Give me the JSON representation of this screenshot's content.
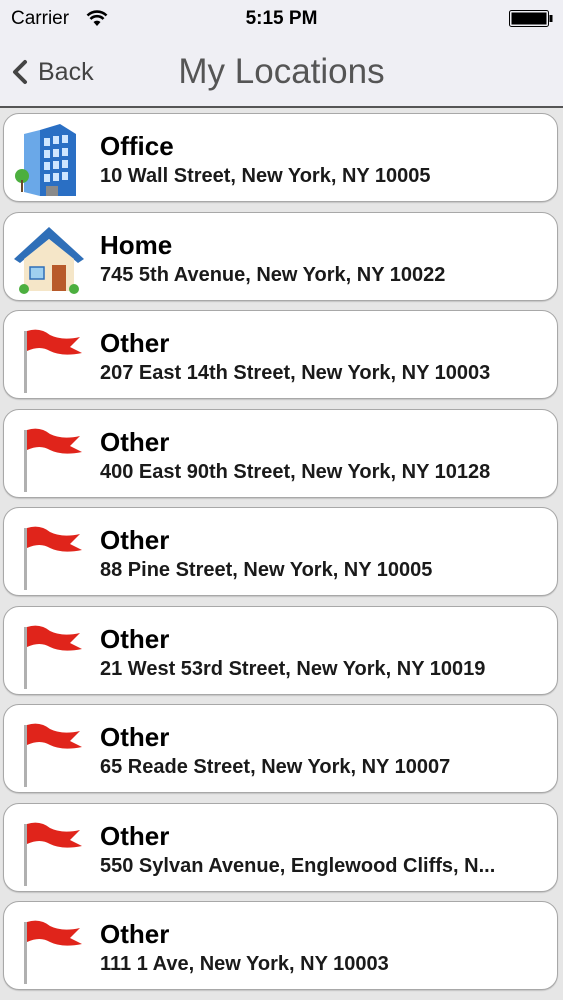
{
  "status_bar": {
    "carrier": "Carrier",
    "time": "5:15 PM"
  },
  "nav": {
    "back_label": "Back",
    "title": "My Locations"
  },
  "locations": [
    {
      "name": "Office",
      "address": "10 Wall Street, New York, NY 10005",
      "icon": "office-building-icon"
    },
    {
      "name": "Home",
      "address": "745 5th Avenue, New York, NY 10022",
      "icon": "house-icon"
    },
    {
      "name": "Other",
      "address": "207 East 14th Street, New York, NY 10003",
      "icon": "red-flag-icon"
    },
    {
      "name": "Other",
      "address": "400 East 90th Street, New York, NY 10128",
      "icon": "red-flag-icon"
    },
    {
      "name": "Other",
      "address": "88 Pine Street, New York, NY 10005",
      "icon": "red-flag-icon"
    },
    {
      "name": "Other",
      "address": "21 West 53rd Street, New York, NY 10019",
      "icon": "red-flag-icon"
    },
    {
      "name": "Other",
      "address": "65 Reade Street, New York, NY 10007",
      "icon": "red-flag-icon"
    },
    {
      "name": "Other",
      "address": "550 Sylvan Avenue, Englewood Cliffs, N...",
      "icon": "red-flag-icon"
    },
    {
      "name": "Other",
      "address": "111 1 Ave, New York, NY 10003",
      "icon": "red-flag-icon"
    }
  ]
}
